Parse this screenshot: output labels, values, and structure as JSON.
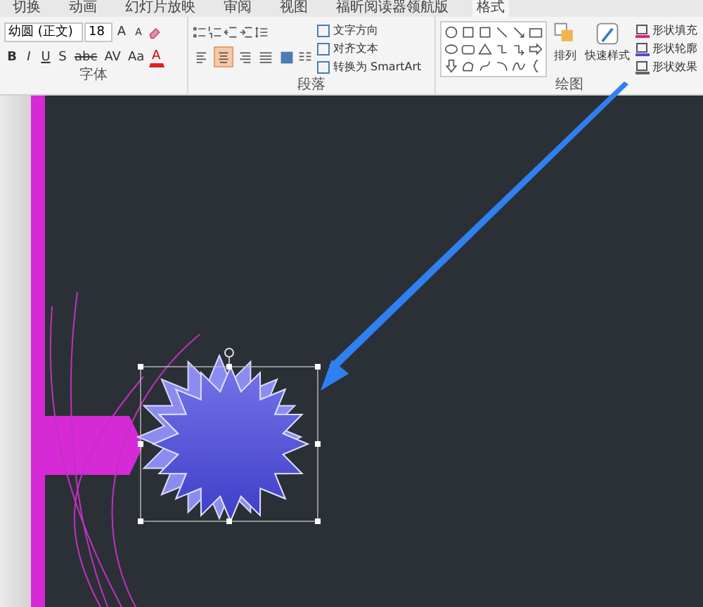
{
  "tabs": [
    {
      "label": "切换",
      "selected": false
    },
    {
      "label": "动画",
      "selected": false
    },
    {
      "label": "幻灯片放映",
      "selected": false
    },
    {
      "label": "审阅",
      "selected": false
    },
    {
      "label": "视图",
      "selected": false
    },
    {
      "label": "福昕阅读器领航版",
      "selected": false
    },
    {
      "label": "格式",
      "selected": true
    }
  ],
  "font_group": {
    "label": "字体",
    "font_name": "幼圆 (正文)",
    "font_size": "18",
    "grow": "A",
    "shrink": "A",
    "format_buttons": [
      "B",
      "I",
      "U",
      "S",
      "abc",
      "AV",
      "Aa"
    ],
    "font_color": "A"
  },
  "paragraph_group": {
    "label": "段落",
    "alignments": [
      {
        "kind": "left",
        "selected": false
      },
      {
        "kind": "center",
        "selected": true
      },
      {
        "kind": "right",
        "selected": false
      },
      {
        "kind": "justify",
        "selected": false
      },
      {
        "kind": "distribute",
        "selected": false
      }
    ],
    "text_commands": [
      "文字方向",
      "对齐文本",
      "转换为 SmartArt"
    ]
  },
  "drawing_group": {
    "label": "绘图",
    "arrange": "排列",
    "quick_styles": "快速样式",
    "shape_commands": [
      {
        "kind": "fill",
        "label": "形状填充"
      },
      {
        "kind": "outline",
        "label": "形状轮廓"
      },
      {
        "kind": "effects",
        "label": "形状效果"
      }
    ]
  },
  "slide": {
    "shape": {
      "kind": "starburst",
      "selected": true
    }
  }
}
